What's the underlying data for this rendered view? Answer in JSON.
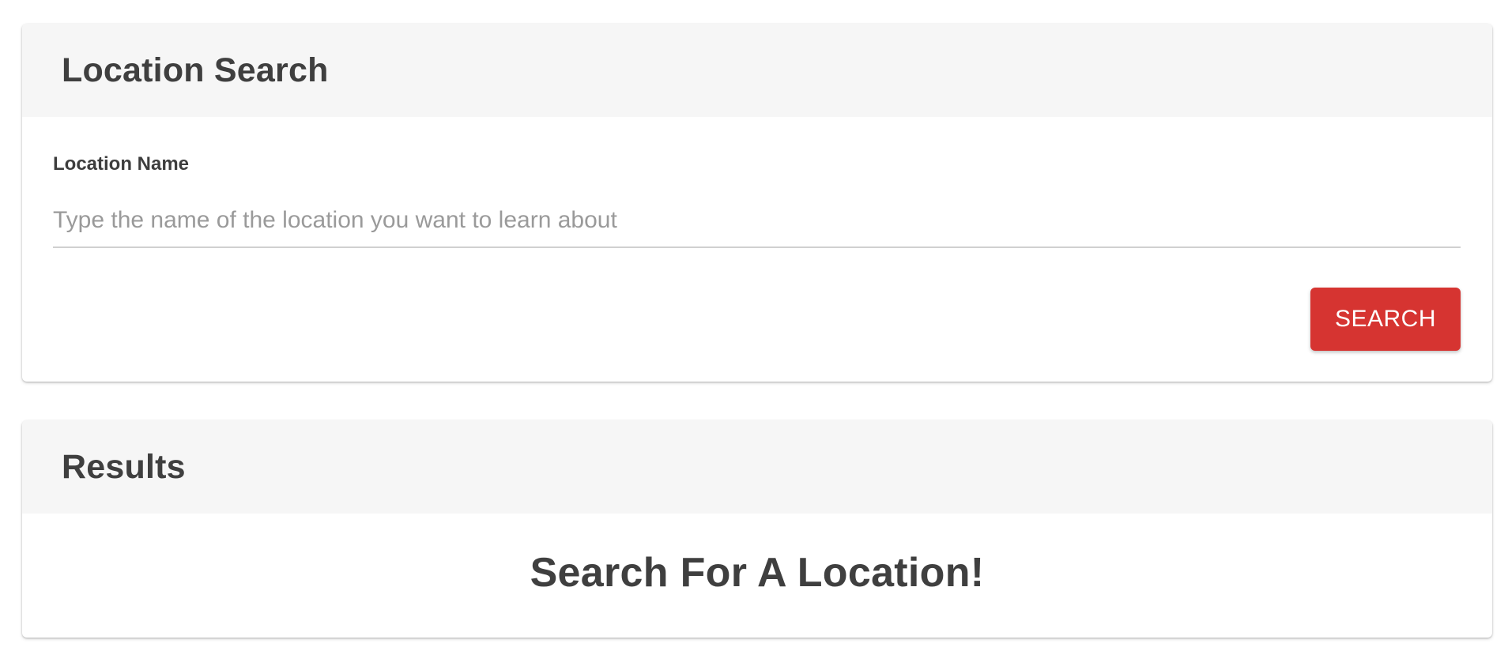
{
  "search_card": {
    "title": "Location Search",
    "field_label": "Location Name",
    "input": {
      "value": "",
      "placeholder": "Type the name of the location you want to learn about"
    },
    "search_label": "SEARCH"
  },
  "results_card": {
    "title": "Results",
    "message": "Search For A Location!"
  },
  "colors": {
    "accent": "#d63431",
    "header_bg": "#f6f6f6",
    "text": "#404040"
  }
}
